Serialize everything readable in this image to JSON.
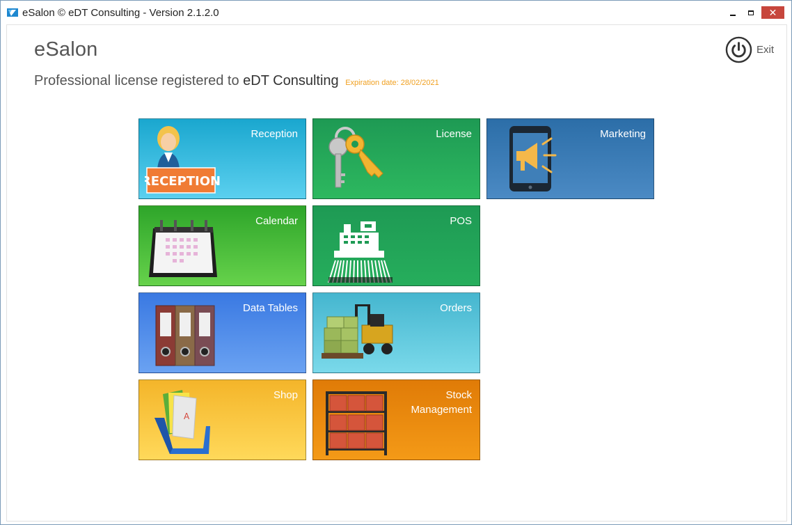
{
  "window": {
    "title": "eSalon © eDT Consulting - Version 2.1.2.0",
    "controls": {
      "minimize": "minimize-icon",
      "maximize": "maximize-icon",
      "close": "✕"
    }
  },
  "header": {
    "app_name": "eSalon",
    "license_prefix": "Professional license registered to",
    "license_owner": "eDT Consulting",
    "expiration": "Expiration date: 28/02/2021",
    "exit_label": "Exit"
  },
  "tiles": [
    {
      "label": "Reception",
      "icon": "receptionist-icon",
      "art_text": "RECEPTION"
    },
    {
      "label": "License",
      "icon": "keys-icon"
    },
    {
      "label": "Marketing",
      "icon": "megaphone-phone-icon"
    },
    {
      "label": "Calendar",
      "icon": "calendar-icon"
    },
    {
      "label": "POS",
      "icon": "cash-register-icon"
    },
    {
      "label": "Data Tables",
      "icon": "binders-icon"
    },
    {
      "label": "Orders",
      "icon": "forklift-icon"
    },
    {
      "label": "Shop",
      "icon": "file-folders-icon"
    },
    {
      "label": "Stock\nManagement",
      "icon": "storage-rack-icon"
    }
  ],
  "colors": {
    "accent_orange": "#f0a020",
    "close_button": "#c7463c",
    "reception": "#1aa7cf",
    "license": "#1e9a54",
    "marketing": "#2c6ea8",
    "calendar": "#2ea52a",
    "pos": "#1e9a54",
    "datatables": "#3a79e2",
    "orders": "#45b6cf",
    "shop": "#f4b52a",
    "stock": "#e07b07"
  }
}
